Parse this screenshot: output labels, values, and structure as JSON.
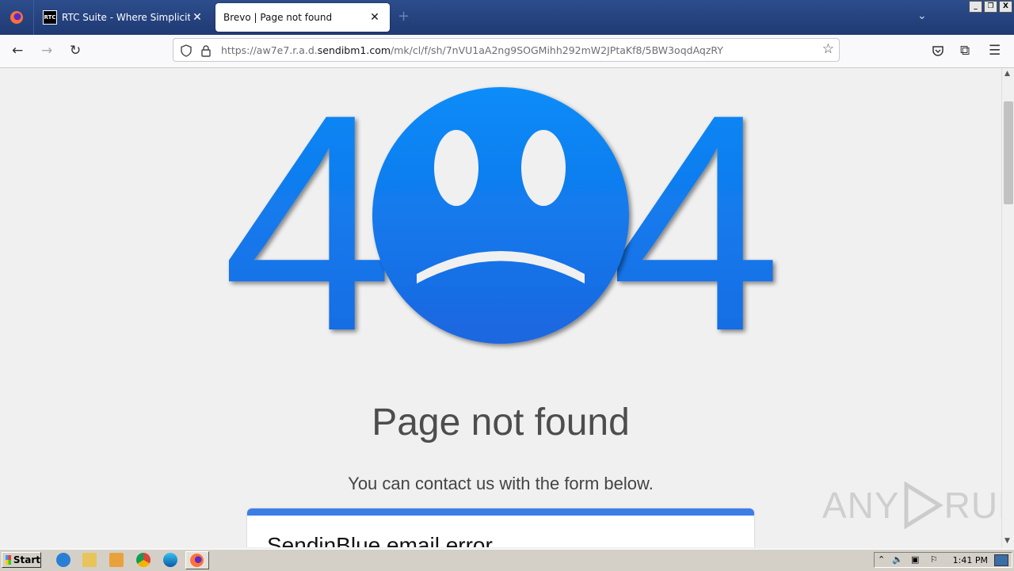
{
  "tabs": [
    {
      "label": "RTC Suite - Where Simplicity Builds",
      "favicon_text": "RTC",
      "active": false
    },
    {
      "label": "Brevo | Page not found",
      "active": true
    }
  ],
  "new_tab_symbol": "+",
  "window_controls": [
    "_",
    "❐",
    "X"
  ],
  "url": {
    "prefix": "https://aw7e7.r.a.d.",
    "domain": "sendibm1.com",
    "path": "/mk/cl/f/sh/7nVU1aA2ng9SOGMihh292mW2JPtaKf8/5BW3oqdAqzRY"
  },
  "page": {
    "art_digits": [
      "4",
      "4"
    ],
    "title": "Page not found",
    "subtitle": "You can contact us with the form below.",
    "card_title": "SendinBlue email error"
  },
  "watermark": {
    "left": "ANY",
    "right": "RUN"
  },
  "taskbar": {
    "start_label": "Start",
    "clock": "1:41 PM"
  },
  "colors": {
    "accent_blue": "#1e7ef2",
    "card_bar": "#3d7ee6",
    "tab_strip": "#2d4d8c"
  }
}
